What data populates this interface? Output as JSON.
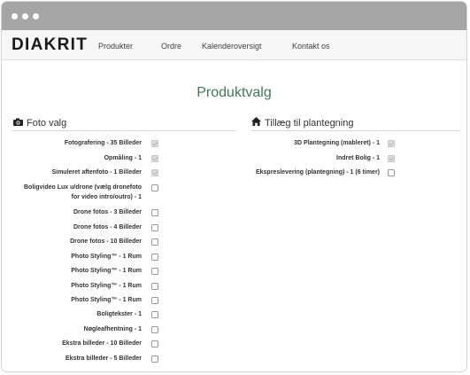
{
  "brand": {
    "logo": "DIAKRIT"
  },
  "nav": [
    {
      "label": "Produkter"
    },
    {
      "label": "Ordre"
    },
    {
      "label": "Kalenderoversigt"
    },
    {
      "label": "Kontakt os"
    }
  ],
  "page": {
    "title": "Produktvalg"
  },
  "foto": {
    "heading": "Foto valg",
    "icon": "camera-icon",
    "items": [
      {
        "label": "Fotografering - 35 Billeder",
        "checked": true
      },
      {
        "label": "Opmåling - 1",
        "checked": true
      },
      {
        "label": "Simuleret aftenfoto - 1 Billeder",
        "checked": true
      },
      {
        "label": "Boligvideo Lux u/drone (vælg dronefoto",
        "label2": "for video intro/outro) - 1",
        "checked": false
      },
      {
        "label": "Drone fotos - 3 Billeder",
        "checked": false
      },
      {
        "label": "Drone fotos - 4 Billeder",
        "checked": false
      },
      {
        "label": "Drone fotos - 10 Billeder",
        "checked": false
      },
      {
        "label": "Photo Styling™ - 1 Rum",
        "checked": false
      },
      {
        "label": "Photo Styling™ - 1 Rum",
        "checked": false
      },
      {
        "label": "Photo Styling™ - 1 Rum",
        "checked": false
      },
      {
        "label": "Photo Styling™ - 1 Rum",
        "checked": false
      },
      {
        "label": "Boligtekster - 1",
        "checked": false
      },
      {
        "label": "Nøgleafhentning - 1",
        "checked": false
      },
      {
        "label": "Ekstra billeder - 10 Billeder",
        "checked": false
      },
      {
        "label": "Ekstra billeder - 5 Billeder",
        "checked": false
      }
    ]
  },
  "plan": {
    "heading": "Tillæg til plantegning",
    "icon": "home-icon",
    "items": [
      {
        "label": "3D Plantegning (mableret) - 1",
        "checked": true
      },
      {
        "label": "Indret Bolig - 1",
        "checked": true
      },
      {
        "label": "Ekspreslevering (plantegning) - 1 (6 timer)",
        "checked": false
      }
    ]
  }
}
